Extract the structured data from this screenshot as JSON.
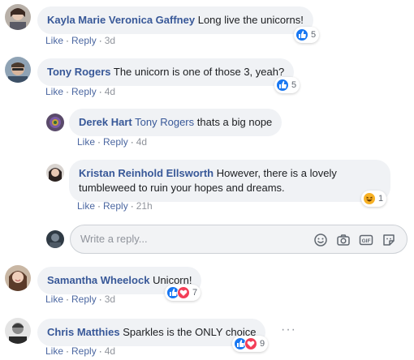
{
  "comments": [
    {
      "author": "Kayla Marie Veronica Gaffney",
      "text": "Long live the unicorns!",
      "like": "Like",
      "reply": "Reply",
      "time": "3d",
      "reaction_count": "5"
    },
    {
      "author": "Tony Rogers",
      "text": "The unicorn is one of those 3, yeah?",
      "like": "Like",
      "reply": "Reply",
      "time": "4d",
      "reaction_count": "5"
    },
    {
      "author": "Samantha Wheelock",
      "text": "Unicorn!",
      "like": "Like",
      "reply": "Reply",
      "time": "3d",
      "reaction_count": "7"
    },
    {
      "author": "Chris Matthies",
      "text": "Sparkles is the ONLY choice",
      "like": "Like",
      "reply": "Reply",
      "time": "4d",
      "reaction_count": "9"
    }
  ],
  "replies": [
    {
      "author": "Derek Hart",
      "mention": "Tony Rogers",
      "text": "thats a big nope",
      "like": "Like",
      "reply": "Reply",
      "time": "4d"
    },
    {
      "author": "Kristan Reinhold Ellsworth",
      "text": "However, there is a lovely tumbleweed to ruin your hopes and dreams.",
      "like": "Like",
      "reply": "Reply",
      "time": "21h",
      "reaction_count": "1"
    }
  ],
  "reply_box": {
    "placeholder": "Write a reply...",
    "icons": [
      "emoji-icon",
      "camera-icon",
      "gif-icon",
      "sticker-icon"
    ]
  },
  "more_options": "···",
  "colors": {
    "author_link": "#385898",
    "bubble_bg": "#f0f2f5",
    "like_blue": "#1877f2",
    "love_red": "#f33e58",
    "haha_yellow": "#f7b125"
  }
}
